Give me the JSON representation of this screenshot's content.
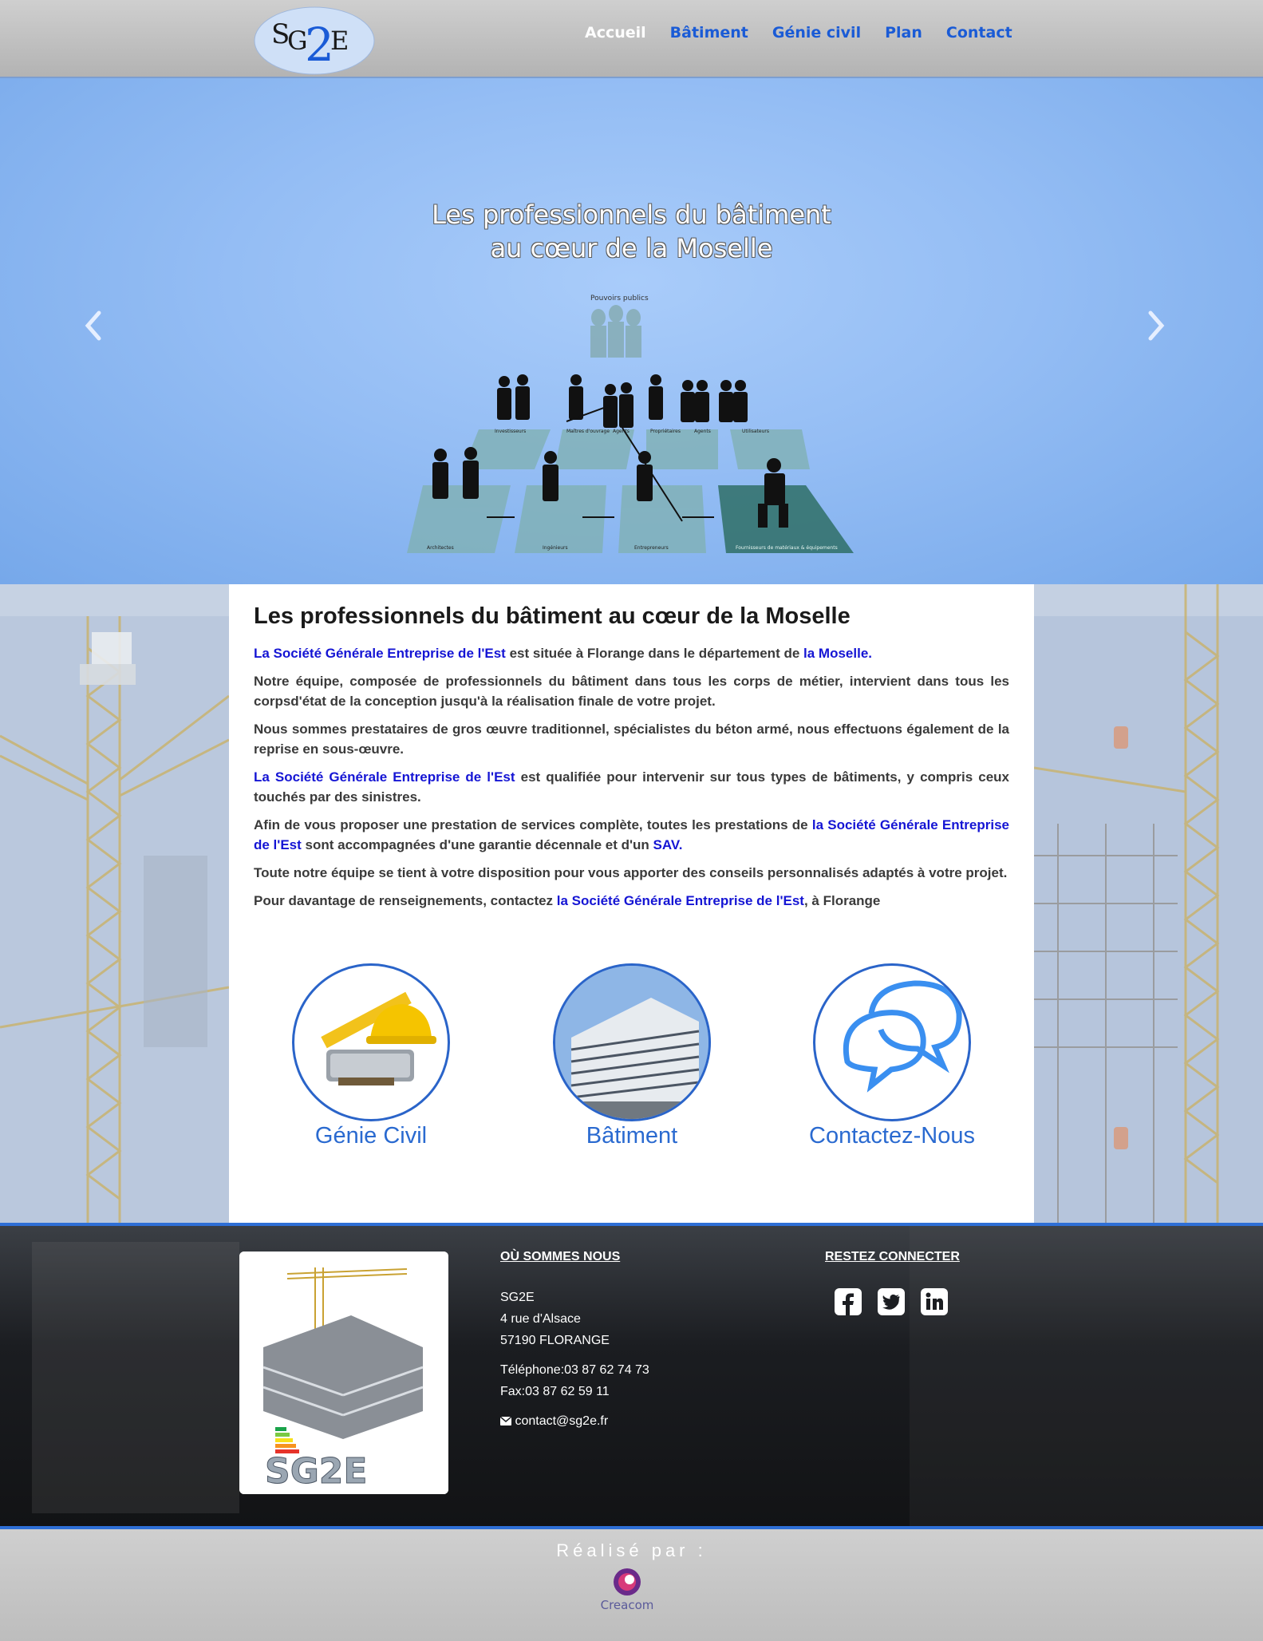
{
  "nav": {
    "logo_text": "SG2E",
    "items": [
      {
        "label": "Accueil",
        "active": true
      },
      {
        "label": "Bâtiment",
        "active": false
      },
      {
        "label": "Génie civil",
        "active": false
      },
      {
        "label": "Plan",
        "active": false
      },
      {
        "label": "Contact",
        "active": false
      }
    ]
  },
  "hero": {
    "title_line1": "Les professionnels du bâtiment",
    "title_line2": "au cœur de la Moselle",
    "diagram_labels": {
      "top": "Pouvoirs publics",
      "row1": [
        "Investisseurs",
        "Maîtres d'ouvrage",
        "Agents",
        "Propriétaires",
        "Agents",
        "Utilisateurs"
      ],
      "row2": [
        "Architectes",
        "Ingénieurs",
        "Entrepreneurs",
        "Fournisseurs de matériaux & équipements"
      ]
    },
    "prev_icon": "chevron-left-icon",
    "next_icon": "chevron-right-icon"
  },
  "main": {
    "heading": "Les professionnels du bâtiment au cœur de la Moselle",
    "p1": {
      "a": "La Société Générale Entreprise de l'Est",
      "b": " est située à Florange dans le département de ",
      "c": "la Moselle",
      "d": "."
    },
    "p2": "Notre équipe, composée de professionnels du bâtiment dans tous les corps de métier, intervient dans tous les corpsd'état de la conception jusqu'à la réalisation finale de votre projet.",
    "p3": "Nous sommes prestataires de gros œuvre traditionnel, spécialistes du béton armé, nous effectuons également de la reprise en sous-œuvre.",
    "p4": {
      "a": "La Société Générale Entreprise de l'Est",
      "b": " est qualifiée pour intervenir sur tous types de bâtiments, y compris ceux touchés par des sinistres."
    },
    "p5": {
      "a": "Afin de vous proposer une prestation de services complète, toutes les prestations de ",
      "b": "la Société Générale Entreprise de l'Est",
      "c": " sont accompagnées d'une garantie décennale et d'un ",
      "d": "SAV",
      "e": "."
    },
    "p6": "Toute notre équipe se tient à votre disposition pour vous apporter des conseils personnalisés adaptés à votre projet.",
    "p7": {
      "a": "Pour davantage de renseignements, contactez ",
      "b": "la Société Générale Entreprise de l'Est",
      "c": ", à Florange"
    },
    "features": [
      {
        "label": "Génie Civil",
        "icon": "tools-helmet-icon"
      },
      {
        "label": "Bâtiment",
        "icon": "building-icon"
      },
      {
        "label": "Contactez-Nous",
        "icon": "speech-bubbles-icon"
      }
    ]
  },
  "footer": {
    "logo_text": "SG2E",
    "where_title": "OÙ SOMMES NOUS",
    "company": "SG2E",
    "street": "4 rue d'Alsace",
    "city": "57190 FLORANGE",
    "phone": "Téléphone:03 87 62 74 73",
    "fax": "Fax:03 87 62 59 11",
    "email": "contact@sg2e.fr",
    "social_title": "RESTEZ CONNECTER",
    "social": [
      "facebook-icon",
      "twitter-icon",
      "linkedin-icon"
    ]
  },
  "credits": {
    "realise": "Réalisé par :",
    "agency": "Creacom"
  },
  "colors": {
    "accent": "#1a5bd6",
    "link": "#1515d4",
    "hero_bg": "#94bdf4",
    "footer_border": "#2e6fd6"
  }
}
